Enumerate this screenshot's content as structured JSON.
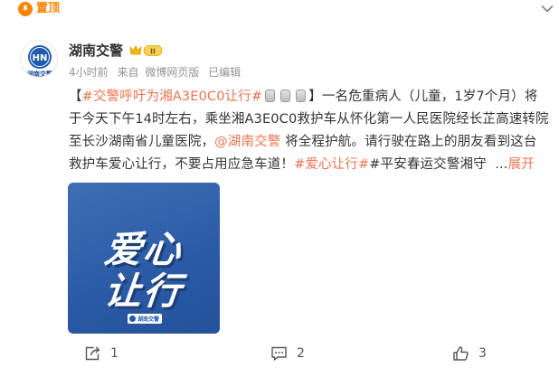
{
  "pinned": {
    "label": "置顶"
  },
  "author": {
    "name": "湖南交警",
    "avatar_text": "湖南交警",
    "avatar_letters": "HN",
    "vip_level": "II"
  },
  "meta": {
    "time": "4小时前",
    "source_prefix": "来自",
    "source": "微博网页版",
    "edited": "已编辑"
  },
  "post": {
    "bracket_open": "【",
    "topic1": "#交警呼吁为湘A3E0C0让行#",
    "bracket_close": "】",
    "text1": "一名危重病人（儿童，1岁7个月）将",
    "line2": "于今天下午14时左右，乘坐湘A3E0C0救护车从怀化第一人民医院经长芷高速转院",
    "line3_a": "至长沙湖南省儿童医院，",
    "mention": "@湖南交警",
    "line3_b": " 将全程护航。请行驶在路上的朋友看到这台",
    "line4_a": "救护车爱心让行，不要占用应急车道！",
    "topic2": "#爱心让行#",
    "topic3": "#平安春运交警湘守",
    "ellipsis": "  ...",
    "expand": "展开"
  },
  "image": {
    "line1": "爱心",
    "line2": "让行",
    "logo_text": "湖南交警"
  },
  "actions": {
    "forward": "1",
    "comment": "2",
    "like": "3"
  },
  "icons": {
    "pin": "pin-icon",
    "more": "chevron-down-icon",
    "forward": "forward-icon",
    "comment": "comment-icon",
    "like": "thumbs-up-icon"
  },
  "colors": {
    "accent": "#ff8200",
    "link": "#eb7350",
    "meta": "#939393",
    "image_bg": "#2a5aa6"
  }
}
